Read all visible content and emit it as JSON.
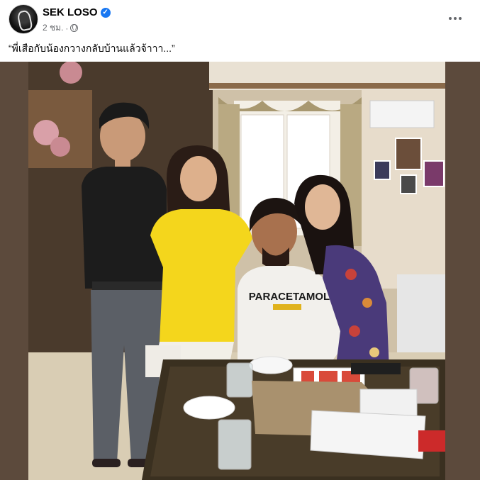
{
  "post": {
    "author": "SEK LOSO",
    "verified": true,
    "timestamp": "2 ชม.",
    "separator": "·",
    "audience_icon": "globe-icon",
    "caption": "“พี่เสือกับน้องกวางกลับบ้านแล้วจ้าาา...”",
    "more_icon": "more-horizontal-icon"
  },
  "photo": {
    "shirt_text": "PARACETAMOL"
  },
  "colors": {
    "accent": "#1877f2",
    "secondary_text": "#65676b",
    "photo_frame": "#5c4a3c"
  }
}
